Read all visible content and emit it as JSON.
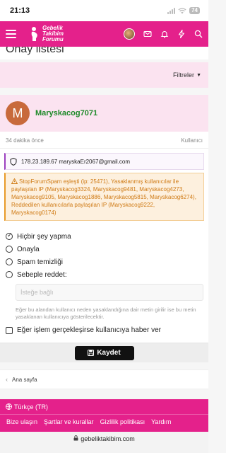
{
  "status_bar": {
    "time": "21:13",
    "battery": "74"
  },
  "colors": {
    "brand_pink": "#e4218b",
    "username_green": "#1f8a2a",
    "warning_orange": "#cf7a14"
  },
  "nav": {
    "logo_lines": [
      "Gebelik",
      "Takibim",
      "Forumu"
    ],
    "icons": [
      "hamburger-icon",
      "avatar",
      "mail-icon",
      "bell-icon",
      "bolt-icon",
      "search-icon"
    ]
  },
  "page": {
    "title": "Onay listesi"
  },
  "filter": {
    "label": "Filtreler"
  },
  "user": {
    "initial": "M",
    "name": "Maryskacog7071",
    "time_ago": "34 dakika önce",
    "role": "Kullanıcı",
    "ip_line": "178.23.189.67 maryskaEr2067@gmail.com",
    "warning": "StopForumSpam eşleşti (ip: 25471), Yasaklanmış kullanıcılar ile paylaşılan IP (Maryskacog3324, Maryskacog9481, Maryskacog4273, Maryskacog9105, Maryskacog1886, Maryskacog5815, Maryskacog6274), Reddedilen kullanıcılarla paylaşılan IP (Maryskacog9222, Maryskacog0174)"
  },
  "actions": {
    "options": [
      "Hiçbir şey yapma",
      "Onayla",
      "Spam temizliği",
      "Sebeple reddet:"
    ],
    "selected": "Hiçbir şey yapma",
    "reason_placeholder": "İsteğe bağlı",
    "help_text": "Eğer bu alandan kullanıcı neden yasaklandığına dair metin girilir ise bu metin yasaklanan kullanıcıya gösterilecektir.",
    "notify_label": "Eğer işlem gerçekleşirse kullanıcıya haber ver",
    "notify_checked": false
  },
  "save": {
    "label": "Kaydet"
  },
  "breadcrumb": {
    "label": "Ana sayfa"
  },
  "footer": {
    "language": "Türkçe (TR)",
    "links": [
      "Bize ulaşın",
      "Şartlar ve kurallar",
      "Gizlilik politikası",
      "Yardım"
    ]
  },
  "browser": {
    "url": "gebeliktakibim.com"
  }
}
